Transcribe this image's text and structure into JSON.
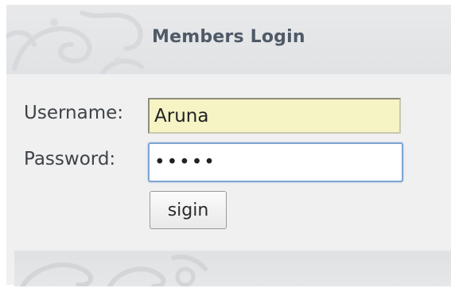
{
  "header": {
    "title": "Members Login"
  },
  "form": {
    "username_label": "Username:",
    "username_value": "Aruna",
    "password_label": "Password:",
    "password_value": "•••••",
    "submit_label": "sigin"
  },
  "colors": {
    "panel_bg": "#f0f0f1",
    "header_bg": "#e2e4e6",
    "title_text": "#4f5a67",
    "username_field_bg": "#f6f3c5",
    "password_focus_border": "#7fa4d3"
  },
  "icons": {
    "header_ornament": "swirl-ornament",
    "footer_ornament": "swirl-ornament"
  }
}
